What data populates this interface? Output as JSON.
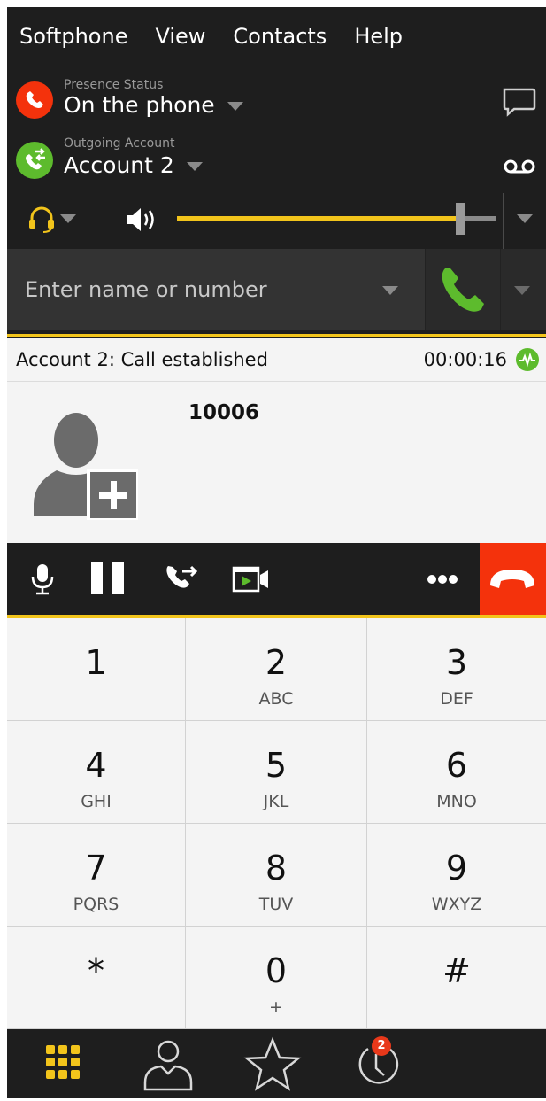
{
  "menu": {
    "items": [
      "Softphone",
      "View",
      "Contacts",
      "Help"
    ]
  },
  "presence": {
    "label": "Presence Status",
    "value": "On the phone"
  },
  "outgoing": {
    "label": "Outgoing Account",
    "value": "Account 2"
  },
  "volume": {
    "level_percent": 88
  },
  "dial": {
    "placeholder": "Enter name or number"
  },
  "call": {
    "status": "Account 2: Call established",
    "duration": "00:00:16",
    "number": "10006"
  },
  "keypad": [
    {
      "digit": "1",
      "letters": ""
    },
    {
      "digit": "2",
      "letters": "ABC"
    },
    {
      "digit": "3",
      "letters": "DEF"
    },
    {
      "digit": "4",
      "letters": "GHI"
    },
    {
      "digit": "5",
      "letters": "JKL"
    },
    {
      "digit": "6",
      "letters": "MNO"
    },
    {
      "digit": "7",
      "letters": "PQRS"
    },
    {
      "digit": "8",
      "letters": "TUV"
    },
    {
      "digit": "9",
      "letters": "WXYZ"
    },
    {
      "digit": "*",
      "letters": ""
    },
    {
      "digit": "0",
      "letters": "+"
    },
    {
      "digit": "#",
      "letters": ""
    }
  ],
  "bottom_nav": {
    "history_badge": "2"
  },
  "colors": {
    "accent": "#f2c41b",
    "presence_busy": "#f4320c",
    "account_green": "#5dbb2d",
    "hangup": "#f4320c",
    "call_green": "#5dbb2d"
  },
  "icons": [
    "phone-busy-icon",
    "account-switch-icon",
    "chat-bubble-icon",
    "voicemail-icon",
    "headset-icon",
    "speaker-icon",
    "call-icon",
    "activity-icon",
    "add-contact-avatar-icon",
    "microphone-icon",
    "pause-icon",
    "transfer-icon",
    "video-icon",
    "more-icon",
    "hangup-icon",
    "dialpad-icon",
    "contacts-icon",
    "favorites-icon",
    "history-icon"
  ]
}
